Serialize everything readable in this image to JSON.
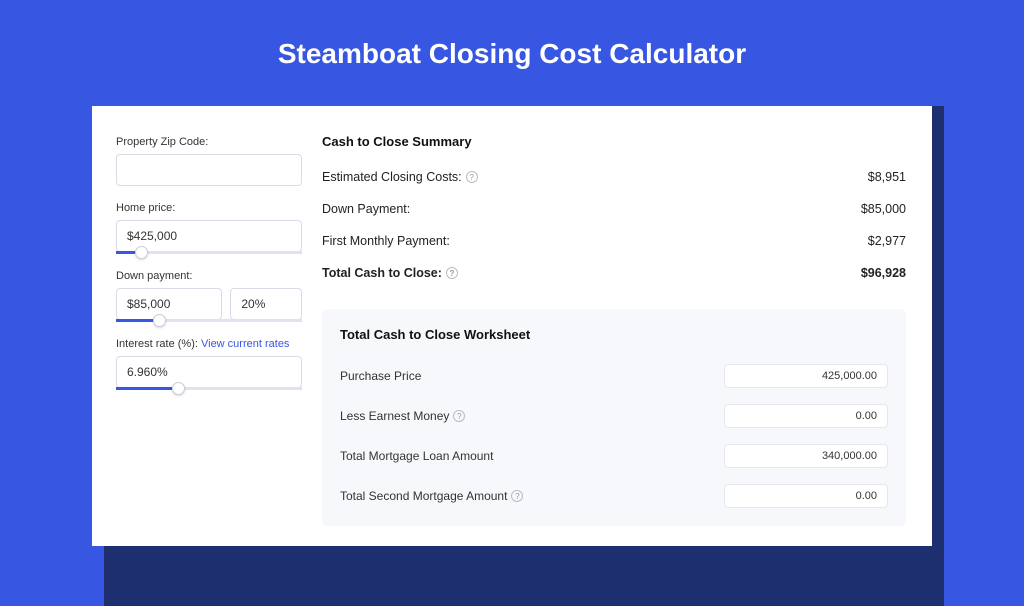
{
  "page_title": "Steamboat Closing Cost Calculator",
  "left": {
    "zip_label": "Property Zip Code:",
    "zip_value": "",
    "home_price_label": "Home price:",
    "home_price_value": "$425,000",
    "home_price_slider_pct": 10,
    "down_payment_label": "Down payment:",
    "down_payment_value": "$85,000",
    "down_payment_pct": "20%",
    "down_payment_slider_pct": 20,
    "interest_label": "Interest rate (%):",
    "interest_link": "View current rates",
    "interest_value": "6.960%",
    "interest_slider_pct": 30
  },
  "summary": {
    "title": "Cash to Close Summary",
    "rows": [
      {
        "label": "Estimated Closing Costs:",
        "value": "$8,951",
        "help": true
      },
      {
        "label": "Down Payment:",
        "value": "$85,000",
        "help": false
      },
      {
        "label": "First Monthly Payment:",
        "value": "$2,977",
        "help": false
      }
    ],
    "total_label": "Total Cash to Close:",
    "total_value": "$96,928"
  },
  "worksheet": {
    "title": "Total Cash to Close Worksheet",
    "rows": [
      {
        "label": "Purchase Price",
        "value": "425,000.00",
        "help": false
      },
      {
        "label": "Less Earnest Money",
        "value": "0.00",
        "help": true
      },
      {
        "label": "Total Mortgage Loan Amount",
        "value": "340,000.00",
        "help": false
      },
      {
        "label": "Total Second Mortgage Amount",
        "value": "0.00",
        "help": true
      }
    ]
  }
}
